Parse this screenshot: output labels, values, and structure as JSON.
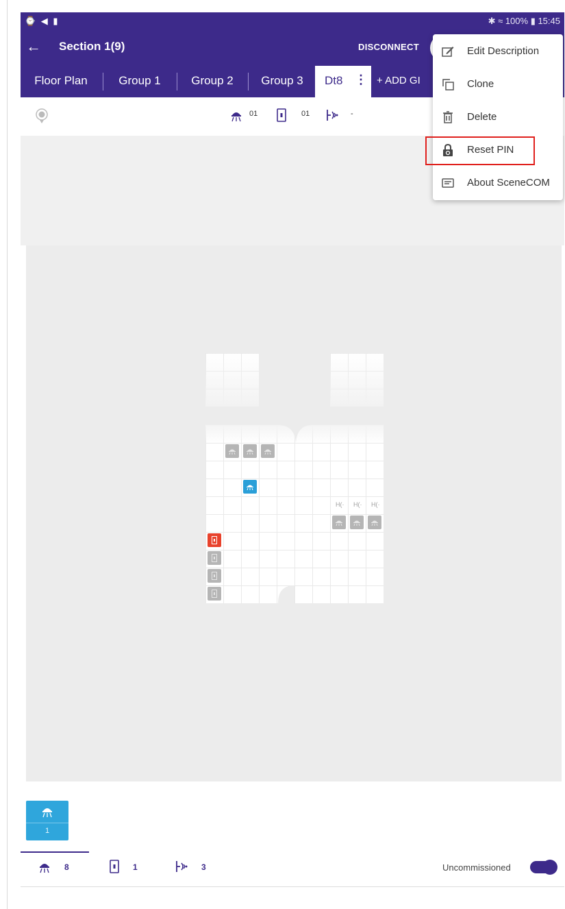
{
  "status_bar": {
    "left_icons": "⌚ ◀ ▮",
    "right_text": "✱ ≈ 100% ▮ 15:45"
  },
  "app_bar": {
    "title": "Section 1(9)",
    "disconnect_label": "DISCONNECT"
  },
  "tabs": [
    {
      "label": "Floor Plan"
    },
    {
      "label": "Group 1"
    },
    {
      "label": "Group 2"
    },
    {
      "label": "Group 3"
    },
    {
      "label": "Dt8",
      "active": true
    },
    {
      "label": "+ ADD GI"
    }
  ],
  "toolbar": {
    "luminaire_count": "01",
    "switch_count": "01",
    "sensor_count": "-"
  },
  "plan": {
    "selected_card_count": "1"
  },
  "bottom_bar": {
    "luminaire_total": "8",
    "switch_total": "1",
    "sensor_total": "3",
    "commission_status": "Uncommissioned",
    "toggle_on": true
  },
  "menu": {
    "items": [
      {
        "label": "Edit Description",
        "icon": "edit-icon"
      },
      {
        "label": "Clone",
        "icon": "clone-icon"
      },
      {
        "label": "Delete",
        "icon": "trash-icon"
      },
      {
        "label": "Reset PIN",
        "icon": "lock-reset-icon",
        "highlighted": true
      },
      {
        "label": "About SceneCOM",
        "icon": "info-card-icon"
      }
    ]
  },
  "colors": {
    "primary": "#3d2a8a",
    "selected": "#2a9fd8",
    "alert": "#e8422c",
    "device": "#b5b5b5",
    "highlight": "#e0201c"
  }
}
